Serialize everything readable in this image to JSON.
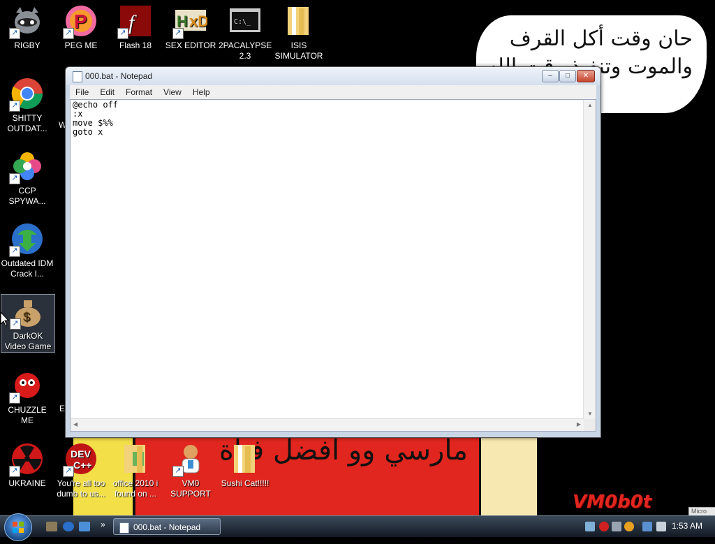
{
  "wallpaper": {
    "speech_text": "حان وقت أكل القرف\nوالموت وتنفيذ وقت الله",
    "banner_text": "مارسي وو افضل فتاة",
    "watermark": "VM0b0t",
    "corner_tab": "Micro"
  },
  "desktop_icons": [
    {
      "label": "RIGBY",
      "icon": "raccoon-icon"
    },
    {
      "label": "PEG ME",
      "icon": "peg-icon"
    },
    {
      "label": "Flash 18",
      "icon": "flash-icon"
    },
    {
      "label": "SEX EDITOR",
      "icon": "hxd-icon"
    },
    {
      "label": "2PACALYPSE 2.3",
      "icon": "terminal-icon"
    },
    {
      "label": "ISIS SIMULATOR",
      "icon": "folder-icon"
    },
    {
      "label": "SHITTY OUTDAT...",
      "icon": "chrome-icon"
    },
    {
      "label": "CCP SPYWA...",
      "icon": "photos-icon"
    },
    {
      "label": "Outdated IDM Crack I...",
      "icon": "idm-icon"
    },
    {
      "label": "DarkOK Video Game",
      "icon": "money-bag-icon"
    },
    {
      "label": "CHUZZLE ME",
      "icon": "chuzzle-icon"
    },
    {
      "label": "UKRAINE",
      "icon": "radiation-icon"
    },
    {
      "label": "You're all too dumb to us...",
      "icon": "devcpp-icon"
    },
    {
      "label": "office 2010 i found on ...",
      "icon": "folder-icon"
    },
    {
      "label": "VM0 SUPPORT",
      "icon": "support-icon"
    },
    {
      "label": "Sushi Cat!!!!!",
      "icon": "folder-icon"
    }
  ],
  "hidden_labels": {
    "w": "W",
    "e": "E"
  },
  "notepad": {
    "title": "000.bat - Notepad",
    "menu": [
      "File",
      "Edit",
      "Format",
      "View",
      "Help"
    ],
    "content": "@echo off\n:x\nmove $%%\ngoto x",
    "controls": {
      "minimize": "–",
      "maximize": "□",
      "close": "✕"
    }
  },
  "taskbar": {
    "task_label": "000.bat - Notepad",
    "chevron": "»",
    "clock": "1:53 AM"
  },
  "colors": {
    "banner_yellow": "#f3df48",
    "banner_red": "#e0261e",
    "taskbar_top": "#3c4a5a"
  }
}
